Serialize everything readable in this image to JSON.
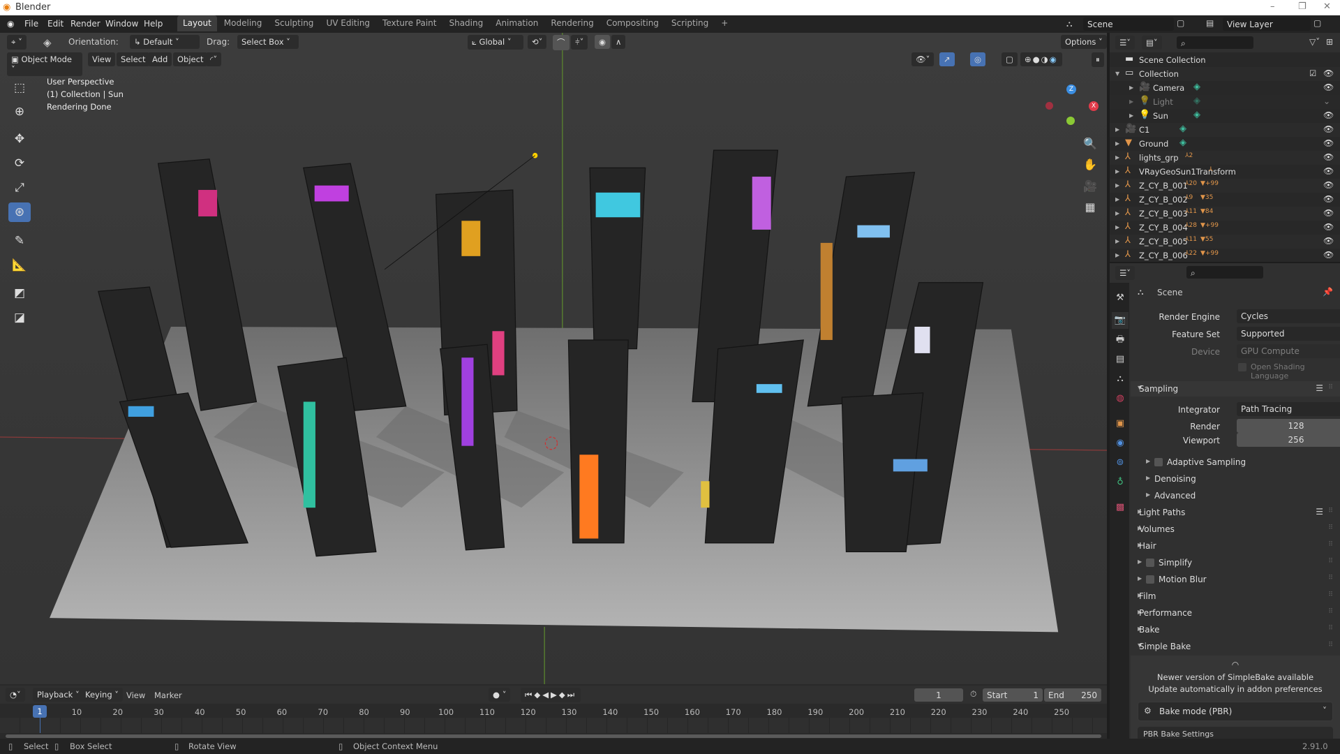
{
  "window": {
    "title": "Blender",
    "minimize": "–",
    "maximize": "❐",
    "close": "✕"
  },
  "menu": [
    "File",
    "Edit",
    "Render",
    "Window",
    "Help"
  ],
  "workspaces": [
    "Layout",
    "Modeling",
    "Sculpting",
    "UV Editing",
    "Texture Paint",
    "Shading",
    "Animation",
    "Rendering",
    "Compositing",
    "Scripting",
    "+"
  ],
  "scene": {
    "name": "Scene",
    "view_layer": "View Layer"
  },
  "toolheader": {
    "orientation_label": "Orientation:",
    "orientation": "Default",
    "drag_label": "Drag:",
    "drag": "Select Box",
    "transform": "Global",
    "options": "Options"
  },
  "viewheader": {
    "mode": "Object Mode",
    "view": "View",
    "select": "Select",
    "add": "Add",
    "object": "Object"
  },
  "overlay": {
    "line1": "User Perspective",
    "line2": "(1) Collection | Sun",
    "line3": "Rendering Done"
  },
  "gizmo": {
    "x": "X",
    "y": "Y",
    "z": "Z"
  },
  "colors": {
    "accent": "#4772b3",
    "x_axis": "#e23b4a",
    "y_axis": "#8bc935",
    "z_axis": "#3b8ee2",
    "object": "#e0954a",
    "data": "#3fbf9f"
  },
  "outliner": {
    "root": "Scene Collection",
    "items": [
      {
        "label": "Collection",
        "indent": 1,
        "icon": "collection",
        "open": true,
        "check": true
      },
      {
        "label": "Camera",
        "indent": 2,
        "icon": "camera",
        "data": "camera-data"
      },
      {
        "label": "Light",
        "indent": 2,
        "icon": "light",
        "data": "light-data",
        "dim": true
      },
      {
        "label": "Sun",
        "indent": 2,
        "icon": "light",
        "data": "sun-data"
      },
      {
        "label": "C1",
        "indent": 1,
        "icon": "camera",
        "data": "camera-data"
      },
      {
        "label": "Ground",
        "indent": 1,
        "icon": "mesh",
        "data": "mesh-data"
      },
      {
        "label": "lights_grp",
        "indent": 1,
        "icon": "empty",
        "b1": "2"
      },
      {
        "label": "VRayGeoSun1Transform",
        "indent": 1,
        "icon": "empty",
        "b1": ""
      },
      {
        "label": "Z_CY_B_001",
        "indent": 1,
        "icon": "empty",
        "b1": "20",
        "b2": "+99"
      },
      {
        "label": "Z_CY_B_002",
        "indent": 1,
        "icon": "empty",
        "b1": "9",
        "b2": "35"
      },
      {
        "label": "Z_CY_B_003",
        "indent": 1,
        "icon": "empty",
        "b1": "11",
        "b2": "84"
      },
      {
        "label": "Z_CY_B_004",
        "indent": 1,
        "icon": "empty",
        "b1": "28",
        "b2": "+99"
      },
      {
        "label": "Z_CY_B_005",
        "indent": 1,
        "icon": "empty",
        "b1": "11",
        "b2": "55"
      },
      {
        "label": "Z_CY_B_006",
        "indent": 1,
        "icon": "empty",
        "b1": "22",
        "b2": "+99"
      }
    ]
  },
  "properties": {
    "context": "Scene",
    "render_engine_label": "Render Engine",
    "render_engine": "Cycles",
    "feature_set_label": "Feature Set",
    "feature_set": "Supported",
    "device_label": "Device",
    "device": "GPU Compute",
    "osl": "Open Shading Language",
    "sampling": "Sampling",
    "integrator_label": "Integrator",
    "integrator": "Path Tracing",
    "render_label": "Render",
    "render": "128",
    "viewport_label": "Viewport",
    "viewport": "256",
    "adaptive": "Adaptive Sampling",
    "denoising": "Denoising",
    "advanced": "Advanced",
    "panels": [
      "Light Paths",
      "Volumes",
      "Hair",
      "Simplify",
      "Motion Blur",
      "Film",
      "Performance",
      "Bake"
    ],
    "simple_bake": "Simple Bake",
    "msg1": "Newer version of SimpleBake available",
    "msg2": "Update automatically in addon preferences",
    "bake_mode": "Bake mode (PBR)",
    "pbr_settings": "PBR Bake Settings"
  },
  "timeline": {
    "playback": "Playback",
    "keying": "Keying",
    "view": "View",
    "marker": "Marker",
    "current": "1",
    "start_label": "Start",
    "start": "1",
    "end_label": "End",
    "end": "250",
    "ticks": [
      "10",
      "20",
      "30",
      "40",
      "50",
      "60",
      "70",
      "80",
      "90",
      "100",
      "110",
      "120",
      "130",
      "140",
      "150",
      "160",
      "170",
      "180",
      "190",
      "200",
      "210",
      "220",
      "230",
      "240",
      "250"
    ]
  },
  "status": {
    "select": "Select",
    "box_select": "Box Select",
    "rotate": "Rotate View",
    "context_menu": "Object Context Menu",
    "version": "2.91.0"
  }
}
